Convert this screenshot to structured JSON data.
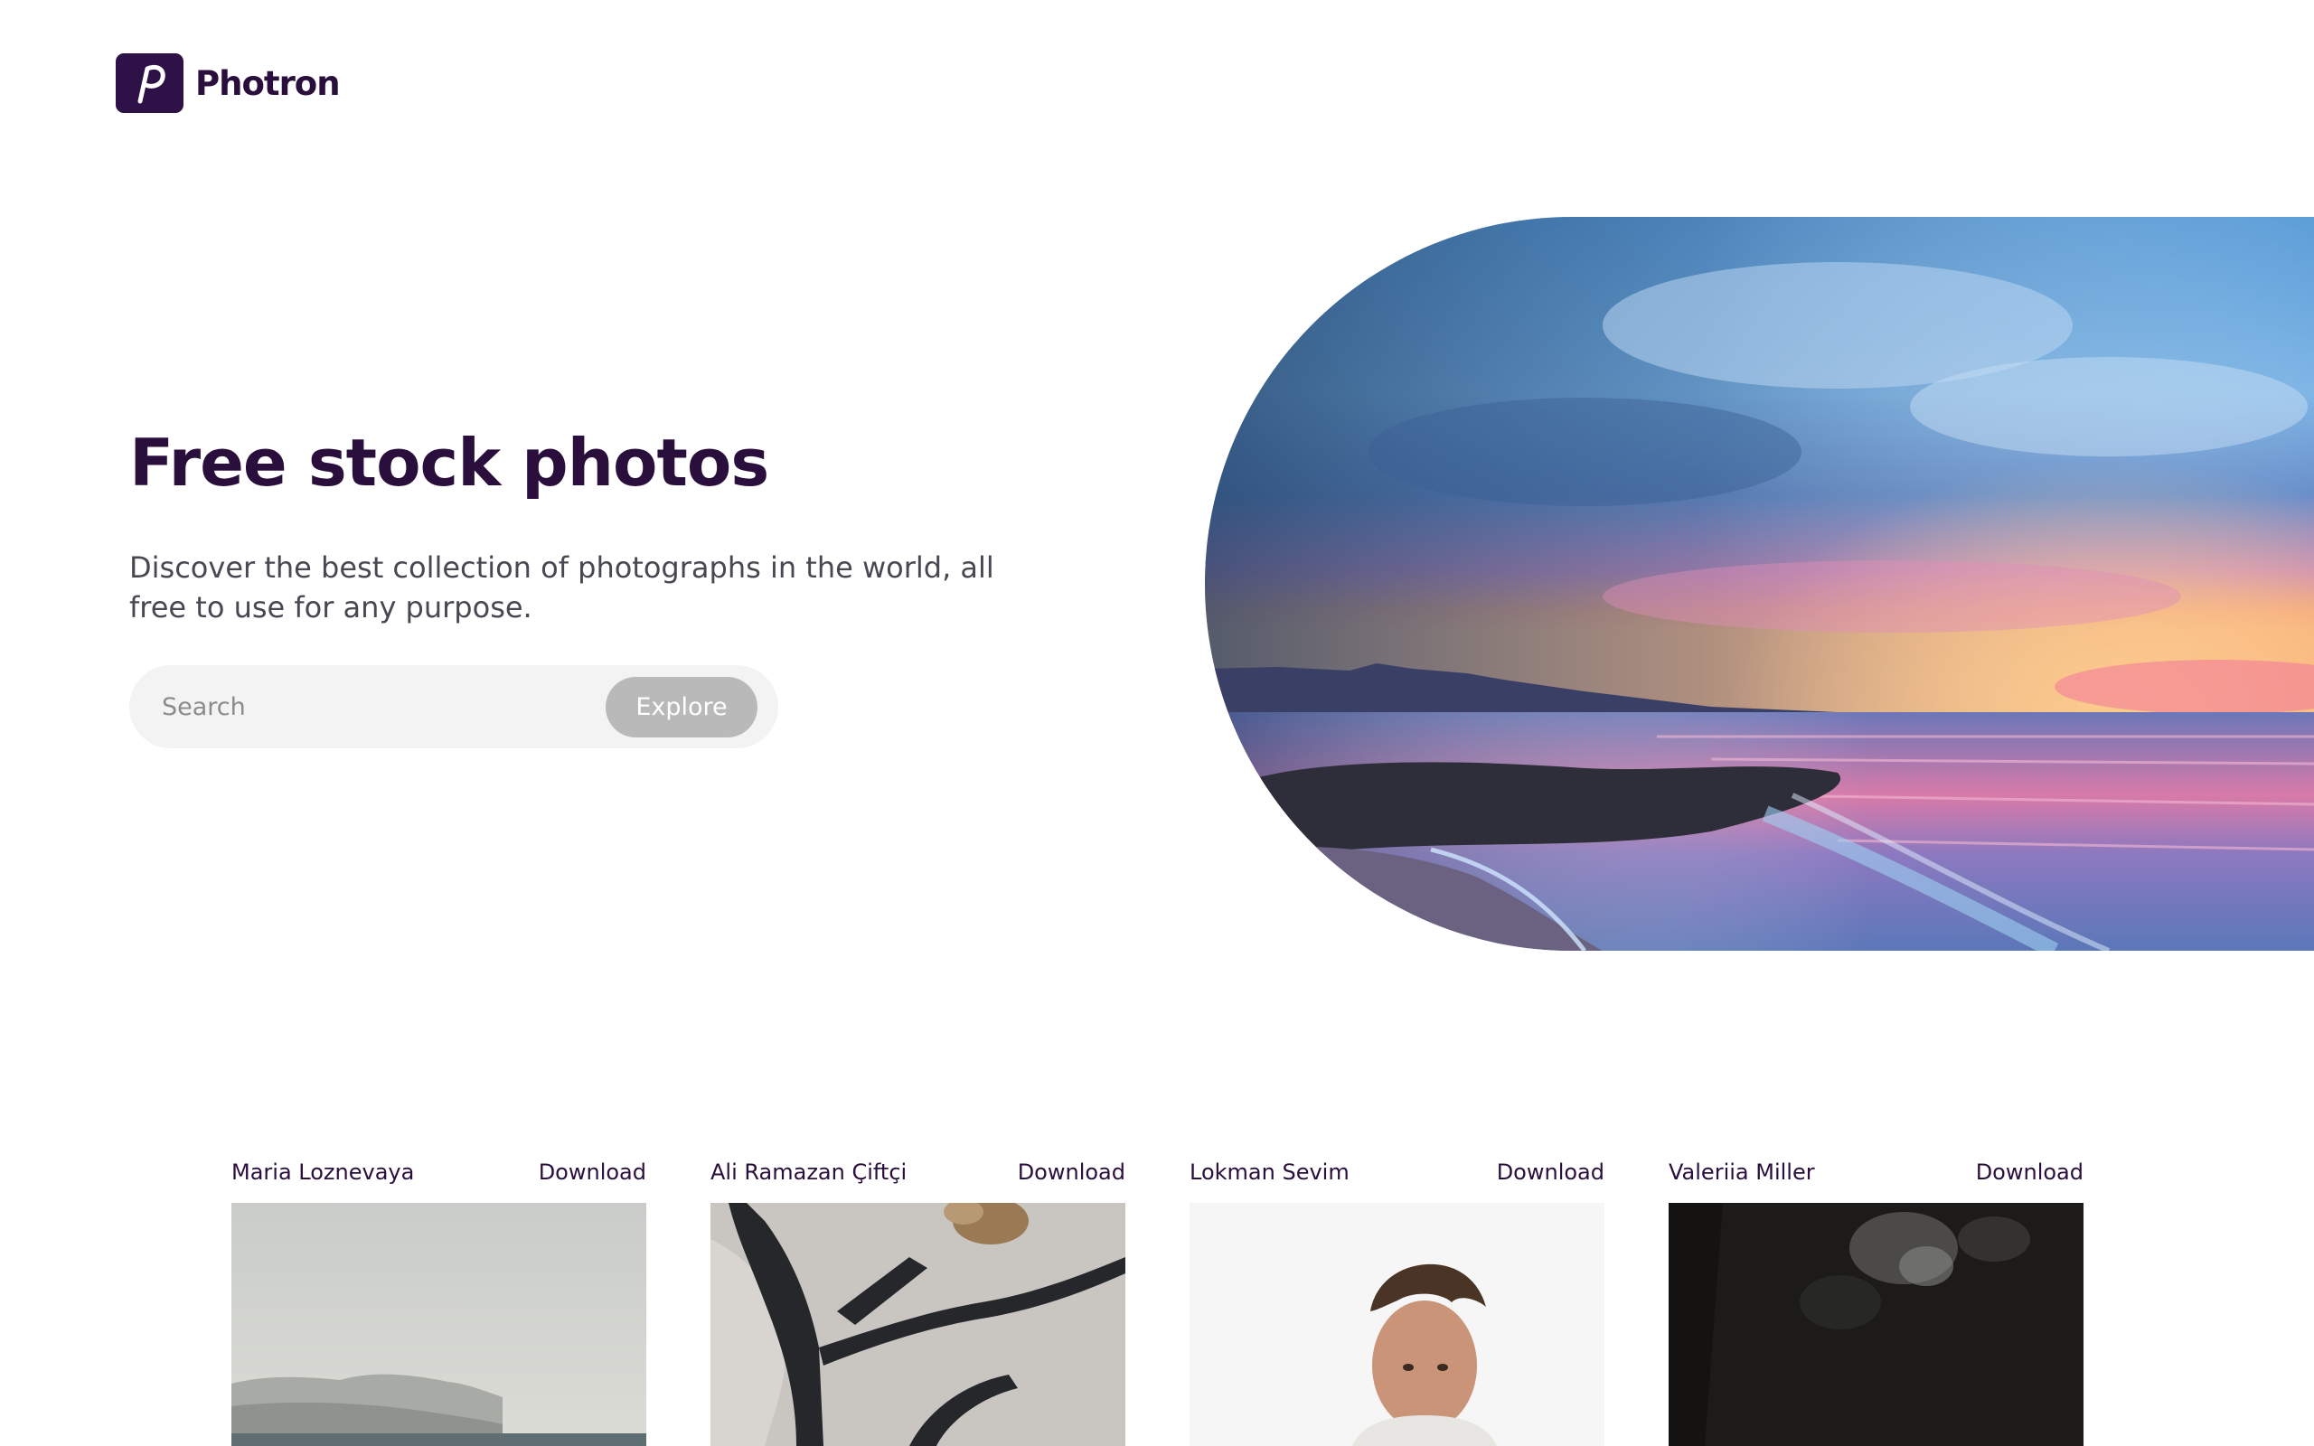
{
  "brand": {
    "name": "Photron",
    "logo_letter": "P",
    "logo_bg": "#2e1147",
    "text_color": "#2a0f3d"
  },
  "hero": {
    "title": "Free stock photos",
    "subtitle": "Discover the best collection of photographs in the world, all free to use for any purpose.",
    "image_icon": "seascape-sunset-photo"
  },
  "search": {
    "placeholder": "Search",
    "value": "",
    "button_label": "Explore",
    "button_color": "#b9b9b9"
  },
  "photos": [
    {
      "author": "Maria Loznevaya",
      "download_label": "Download"
    },
    {
      "author": "Ali Ramazan Çiftçi",
      "download_label": "Download"
    },
    {
      "author": "Lokman Sevim",
      "download_label": "Download"
    },
    {
      "author": "Valeriia Miller",
      "download_label": "Download"
    }
  ]
}
